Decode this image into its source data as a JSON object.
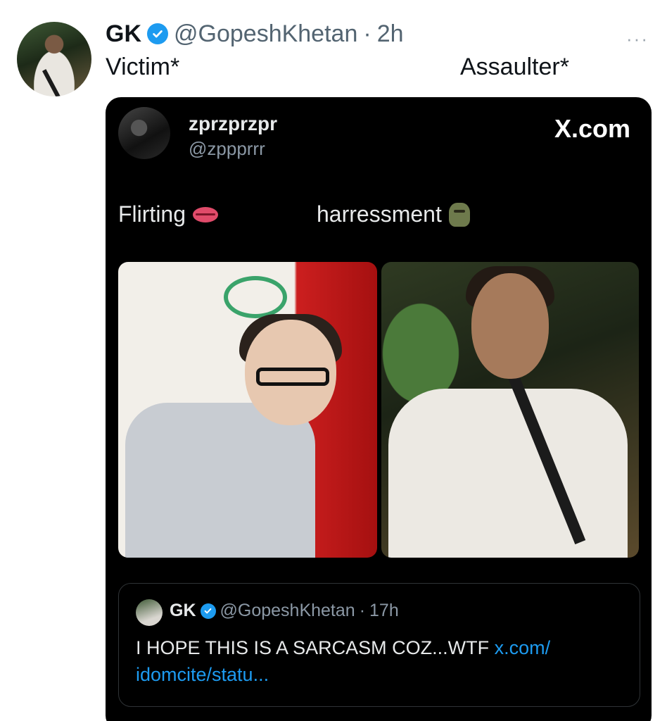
{
  "tweet": {
    "display_name": "GK",
    "handle": "@GopeshKhetan",
    "separator": "·",
    "time": "2h",
    "more": "···",
    "text_left": "Victim*",
    "text_right": "Assaulter*"
  },
  "embedded_card": {
    "display_name": "zprzprzpr",
    "handle": "@zppprrr",
    "brand": "X.com",
    "text_left": "Flirting",
    "text_right": "harressment",
    "quoted": {
      "display_name": "GK",
      "handle": "@GopeshKhetan",
      "separator": "·",
      "time": "17h",
      "text": "I HOPE THIS IS A SARCASM COZ...WTF",
      "link": "x.com/ idomcite/statu..."
    }
  },
  "colors": {
    "verified_badge": "#1d9bf0",
    "link": "#1d9bf0",
    "card_background": "#000000"
  },
  "icons": [
    "verified-badge-icon",
    "more-options-icon",
    "lips-emoji-icon",
    "troll-emoji-icon",
    "x-logo-icon"
  ]
}
